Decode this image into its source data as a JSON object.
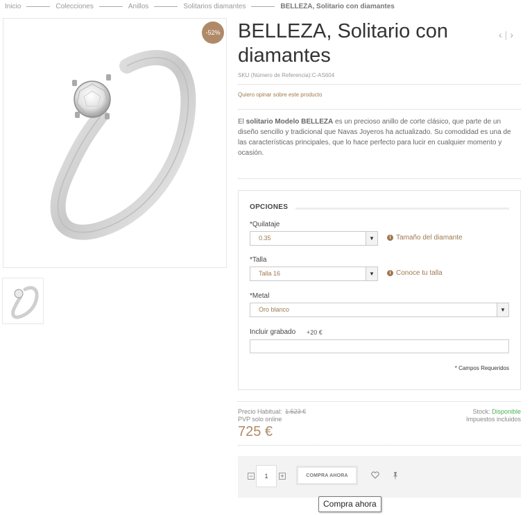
{
  "breadcrumb": {
    "items": [
      "Inicio",
      "Colecciones",
      "Anillos",
      "Solitarios diamantes"
    ],
    "current": "BELLEZA, Solitario con diamantes"
  },
  "product": {
    "discount_badge": "-52%",
    "title": "BELLEZA, Solitario con diamantes",
    "pager": {
      "prev": "‹",
      "separator": "|",
      "next": "›"
    },
    "sku": "SKU (Número de Referencia):C-AS604",
    "review_link": "Quiero opinar sobre este producto",
    "description": {
      "intro": "El ",
      "bold": "solitario Modelo BELLEZA",
      "rest": " es un precioso anillo de corte clásico, que parte de un diseño sencillo y tradicional que Navas Joyeros ha actualizado. Su comodidad es una de las características principales, que lo hace perfecto para lucir en cualquier momento y ocasión."
    }
  },
  "options": {
    "title": "OPCIONES",
    "quilataje": {
      "label": "*Quilataje",
      "value": "0.35",
      "help": "Tamaño del diamante"
    },
    "talla": {
      "label": "*Talla",
      "value": "Talla 16",
      "help": "Conoce tu talla"
    },
    "metal": {
      "label": "*Metal",
      "value": "Oro blanco"
    },
    "engraving": {
      "label": "Incluir grabado",
      "price": "+20 €",
      "value": ""
    },
    "required_note": "* Campos Requeridos"
  },
  "pricing": {
    "regular_label": "Precio Habitual:",
    "regular_price": "1.523 €",
    "online_label": "PVP solo online",
    "price": "725 €",
    "stock_label": "Stock:",
    "stock_value": "Disponible",
    "taxes": "Impuestos incluidos"
  },
  "buy": {
    "minus": "−",
    "plus": "+",
    "quantity": "1",
    "button": "COMPRA AHORA",
    "tooltip": "Compra ahora"
  },
  "colors": {
    "accent": "#b08a68",
    "link": "#a07850",
    "stock_ok": "#4caf50"
  }
}
